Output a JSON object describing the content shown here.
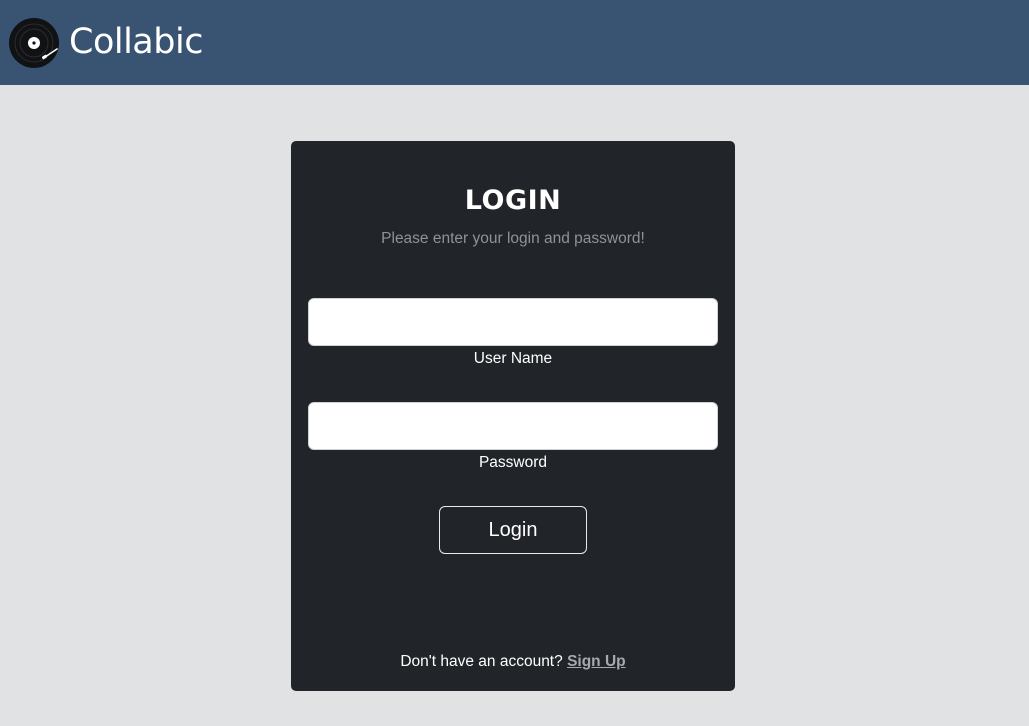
{
  "navbar": {
    "brand_name": "Collabic",
    "logo_icon": "vinyl-record-icon",
    "background_color": "#395373"
  },
  "login_card": {
    "title": "LOGIN",
    "subtitle": "Please enter your login and password!",
    "username": {
      "label": "User Name",
      "value": "",
      "placeholder": ""
    },
    "password": {
      "label": "Password",
      "value": "",
      "placeholder": ""
    },
    "login_button_label": "Login",
    "signup_prompt": "Don't have an account?",
    "signup_link_label": "Sign Up"
  },
  "colors": {
    "page_background": "#e1e2e4",
    "card_background": "#212428",
    "muted_text": "#8f9296"
  }
}
